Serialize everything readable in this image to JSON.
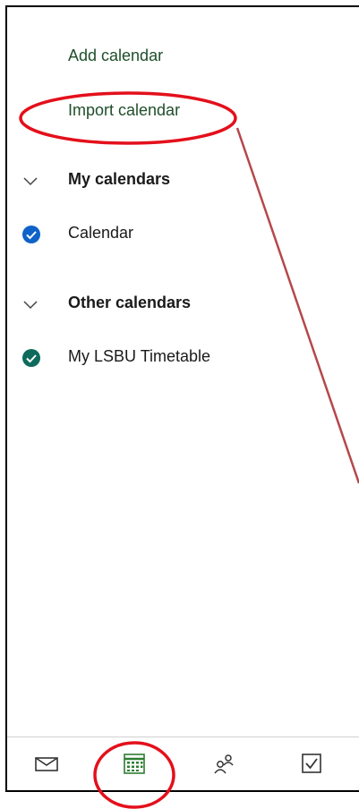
{
  "actions": {
    "add_calendar": "Add calendar",
    "import_calendar": "Import calendar"
  },
  "sections": {
    "my_calendars": {
      "label": "My calendars",
      "items": [
        {
          "label": "Calendar",
          "color": "#0f62c7",
          "checked": true
        }
      ]
    },
    "other_calendars": {
      "label": "Other calendars",
      "items": [
        {
          "label": "My LSBU Timetable",
          "color": "#0e6b5c",
          "checked": true
        }
      ]
    }
  },
  "bottom_nav": {
    "items": [
      {
        "icon": "mail-icon"
      },
      {
        "icon": "calendar-icon",
        "active": true,
        "color": "#2e7d32"
      },
      {
        "icon": "people-icon"
      },
      {
        "icon": "todo-icon"
      }
    ]
  },
  "annotations": {
    "highlight_color": "#e3101b",
    "arrow_color": "#b5484a"
  }
}
